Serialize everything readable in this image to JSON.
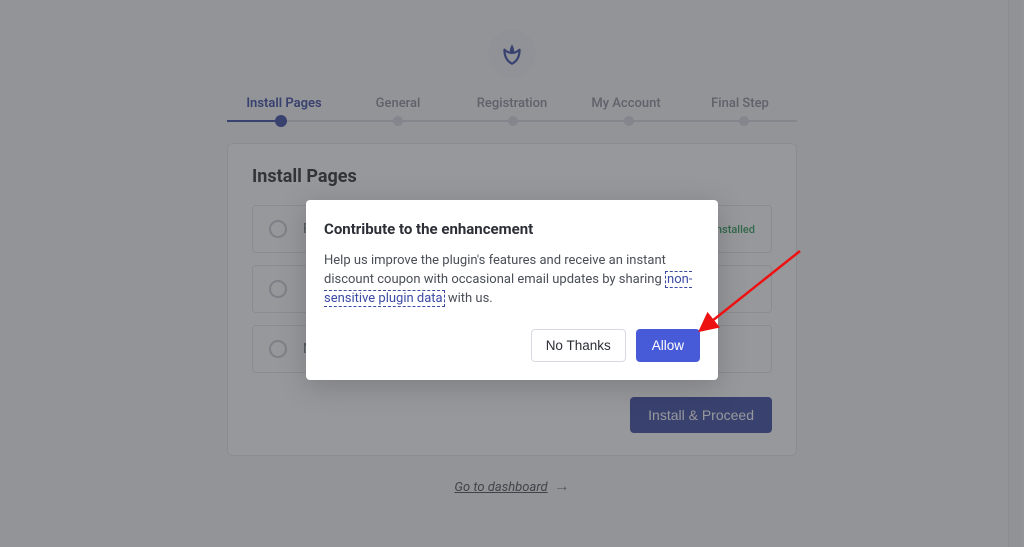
{
  "stepper": {
    "steps": [
      "Install Pages",
      "General",
      "Registration",
      "My Account",
      "Final Step"
    ],
    "active_index": 0
  },
  "card": {
    "title": "Install Pages",
    "rows": [
      {
        "label": "Registration",
        "installed_badge": "Installed"
      },
      {
        "label": ""
      },
      {
        "label": "My Account Page"
      }
    ],
    "proceed_label": "Install & Proceed"
  },
  "dashboard_link": "Go to dashboard",
  "modal": {
    "title": "Contribute to the enhancement",
    "body_before": "Help us improve the plugin's features and receive an instant discount coupon with occasional email updates by sharing ",
    "body_link": "non-sensitive plugin data",
    "body_after": " with us.",
    "no_thanks": "No Thanks",
    "allow": "Allow"
  },
  "logo_color": "#3b4aa3"
}
